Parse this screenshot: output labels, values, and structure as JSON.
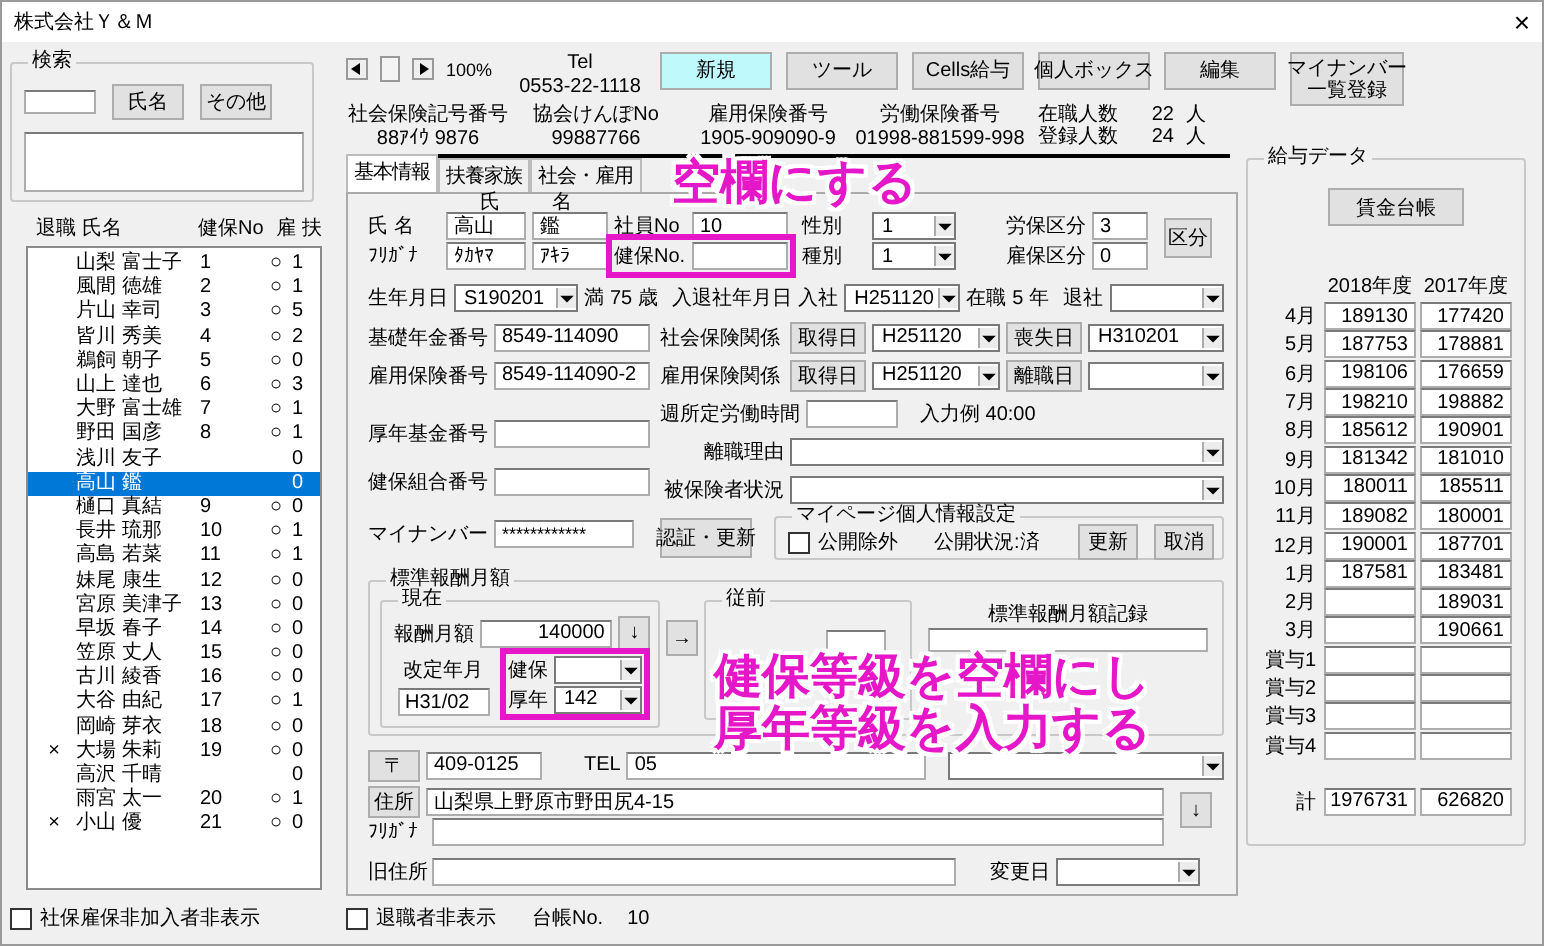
{
  "window": {
    "title": "株式会社Ｙ＆Ｍ",
    "close": "×"
  },
  "search": {
    "label": "検索",
    "buttons": [
      "氏名",
      "その他"
    ]
  },
  "employee_list": {
    "columns": [
      "退職",
      "氏名",
      "健保No",
      "雇",
      "扶"
    ],
    "rows": [
      {
        "name": "山梨 富士子",
        "no": "1",
        "koyo": "○",
        "fu": "1",
        "selected": false
      },
      {
        "name": "風間 徳雄",
        "no": "2",
        "koyo": "○",
        "fu": "1",
        "selected": false
      },
      {
        "name": "片山 幸司",
        "no": "3",
        "koyo": "○",
        "fu": "5",
        "selected": false
      },
      {
        "name": "皆川 秀美",
        "no": "4",
        "koyo": "○",
        "fu": "2",
        "selected": false
      },
      {
        "name": "鵜飼 朝子",
        "no": "5",
        "koyo": "○",
        "fu": "0",
        "selected": false
      },
      {
        "name": "山上 達也",
        "no": "6",
        "koyo": "○",
        "fu": "3",
        "selected": false
      },
      {
        "name": "大野 富士雄",
        "no": "7",
        "koyo": "○",
        "fu": "1",
        "selected": false
      },
      {
        "name": "野田 国彦",
        "no": "8",
        "koyo": "○",
        "fu": "1",
        "selected": false
      },
      {
        "name": "浅川 友子",
        "fu": "0",
        "selected": false
      },
      {
        "name": "高山 鑑",
        "fu": "0",
        "selected": true
      },
      {
        "name": "樋口 真結",
        "no": "9",
        "koyo": "○",
        "fu": "0",
        "selected": false
      },
      {
        "name": "長井 琉那",
        "no": "10",
        "koyo": "○",
        "fu": "1",
        "selected": false
      },
      {
        "name": "高島 若菜",
        "no": "11",
        "koyo": "○",
        "fu": "1",
        "selected": false
      },
      {
        "name": "妹尾 康生",
        "no": "12",
        "koyo": "○",
        "fu": "0",
        "selected": false
      },
      {
        "name": "宮原 美津子",
        "no": "13",
        "koyo": "○",
        "fu": "0",
        "selected": false
      },
      {
        "name": "早坂 春子",
        "no": "14",
        "koyo": "○",
        "fu": "0",
        "selected": false
      },
      {
        "name": "笠原 丈人",
        "no": "15",
        "koyo": "○",
        "fu": "0",
        "selected": false
      },
      {
        "name": "古川 綾香",
        "no": "16",
        "koyo": "○",
        "fu": "0",
        "selected": false
      },
      {
        "name": "大谷 由紀",
        "no": "17",
        "koyo": "○",
        "fu": "1",
        "selected": false
      },
      {
        "name": "岡崎 芽衣",
        "no": "18",
        "koyo": "○",
        "fu": "0",
        "selected": false
      },
      {
        "retired": "×",
        "name": "大場 朱莉",
        "no": "19",
        "koyo": "○",
        "fu": "0",
        "selected": false
      },
      {
        "name": "高沢 千晴",
        "fu": "0",
        "selected": false
      },
      {
        "name": "雨宮 太一",
        "no": "20",
        "koyo": "○",
        "fu": "1",
        "selected": false
      },
      {
        "retired": "×",
        "name": "小山 優",
        "no": "21",
        "koyo": "○",
        "fu": "0",
        "selected": false
      }
    ]
  },
  "hide_uninsured": {
    "label": "社保雇保非加入者非表示",
    "checked": false
  },
  "zoom": "100%",
  "tel": {
    "label": "Tel",
    "value": "0553-22-1118"
  },
  "toolbar": [
    {
      "lines": [
        "新規"
      ],
      "selected": true
    },
    {
      "lines": [
        "ツール"
      ],
      "selected": false
    },
    {
      "lines": [
        "Cells給与"
      ],
      "selected": false
    },
    {
      "lines": [
        "個人ボックス"
      ],
      "selected": false
    },
    {
      "lines": [
        "編集"
      ],
      "selected": false
    },
    {
      "lines": [
        "マイナンバー",
        "一覧登録"
      ],
      "selected": false
    }
  ],
  "insurance_numbers": [
    {
      "label": "社会保険記号番号",
      "value": "88ｱｲｳ 9876"
    },
    {
      "label": "協会けんぽNo",
      "value": "99887766"
    },
    {
      "label": "雇用保険番号",
      "value": "1905-909090-9"
    },
    {
      "label": "労働保険番号",
      "value": "01998-881599-998"
    }
  ],
  "counts": [
    {
      "label": "在職人数",
      "value": "22",
      "unit": "人"
    },
    {
      "label": "登録人数",
      "value": "24",
      "unit": "人"
    }
  ],
  "tabs": [
    {
      "label": "基本情報",
      "selected": true
    },
    {
      "label": "扶養家族",
      "selected": false
    },
    {
      "label": "社会・雇用",
      "selected": false
    }
  ],
  "form": {
    "name_headers": [
      "氏",
      "名"
    ],
    "name": {
      "label": "氏 名",
      "surname": "高山",
      "given": "鑑"
    },
    "furigana": {
      "label": "ﾌﾘｶﾞﾅ",
      "surname": "ﾀｶﾔﾏ",
      "given": "ｱｷﾗ"
    },
    "employee_no": {
      "label": "社員No",
      "value": "10"
    },
    "health_no": {
      "label": "健保No."
    },
    "sex": {
      "label": "性別",
      "value": "1"
    },
    "type": {
      "label": "種別",
      "value": "1"
    },
    "labor_class": {
      "label": "労保区分",
      "value": "3"
    },
    "employment_class": {
      "label": "雇保区分",
      "value": "0"
    },
    "class_button": "区分",
    "birth": {
      "label": "生年月日",
      "value": "S190201",
      "age_prefix": "満",
      "age": "75",
      "age_unit": "歳"
    },
    "join": {
      "label": "入退社年月日",
      "join_label": "入社",
      "join_value": "H251120",
      "tenure_label": "在職",
      "tenure": "5",
      "tenure_unit": "年",
      "leave_label": "退社"
    },
    "pension_no": {
      "label": "基礎年金番号",
      "value": "8549-114090"
    },
    "employment_ins_no": {
      "label": "雇用保険番号",
      "value": "8549-114090-2"
    },
    "pension_fund_no": {
      "label": "厚年基金番号"
    },
    "health_union_no": {
      "label": "健保組合番号"
    },
    "social_ins": {
      "label": "社会保険関係",
      "get_button": "取得日",
      "get_value": "H251120",
      "lose_button": "喪失日",
      "lose_value": "H310201"
    },
    "employment_ins": {
      "label": "雇用保険関係",
      "get_button": "取得日",
      "get_value": "H251120",
      "lose_button": "離職日"
    },
    "weekly_hours": {
      "label": "週所定労働時間",
      "hint": "入力例 40:00"
    },
    "leave_reason": {
      "label": "離職理由"
    },
    "insured_status": {
      "label": "被保険者状況"
    },
    "my_number": {
      "label": "マイナンバー",
      "value": "************",
      "button": "認証・更新"
    },
    "mypage": {
      "title": "マイページ個人情報設定",
      "exclude": {
        "label": "公開除外",
        "checked": false
      },
      "status": "公開状況:済",
      "buttons": [
        "更新",
        "取消"
      ]
    },
    "standard_pay": {
      "title": "標準報酬月額",
      "current": {
        "title": "現在",
        "pay_label": "報酬月額",
        "pay": "140000",
        "down": "↓",
        "revised_label": "改定年月",
        "revised": "H31/02",
        "health_label": "健保",
        "pension_label": "厚年",
        "pension": "142"
      },
      "copy": "→",
      "previous": {
        "title": "従前"
      },
      "history": {
        "title": "標準報酬月額記録"
      }
    },
    "postal": {
      "button": "〒",
      "value": "409-0125",
      "tel_label": "TEL",
      "tel": "05"
    },
    "address": {
      "button": "住所",
      "value": "山梨県上野原市野田尻4-15",
      "down": "↓",
      "furigana_label": "ﾌﾘｶﾞﾅ",
      "old_label": "旧住所",
      "changed_label": "変更日"
    }
  },
  "hide_retired": {
    "label": "退職者非表示",
    "checked": false
  },
  "ledger_no": {
    "label": "台帳No.",
    "value": "10"
  },
  "pay_data": {
    "title": "給与データ",
    "ledger_button": "賃金台帳",
    "years": [
      "2018年度",
      "2017年度"
    ],
    "rows": [
      {
        "month": "4月",
        "y2018": "189130",
        "y2017": "177420"
      },
      {
        "month": "5月",
        "y2018": "187753",
        "y2017": "178881"
      },
      {
        "month": "6月",
        "y2018": "198106",
        "y2017": "176659"
      },
      {
        "month": "7月",
        "y2018": "198210",
        "y2017": "198882"
      },
      {
        "month": "8月",
        "y2018": "185612",
        "y2017": "190901"
      },
      {
        "month": "9月",
        "y2018": "181342",
        "y2017": "181010"
      },
      {
        "month": "10月",
        "y2018": "180011",
        "y2017": "185511"
      },
      {
        "month": "11月",
        "y2018": "189082",
        "y2017": "180001"
      },
      {
        "month": "12月",
        "y2018": "190001",
        "y2017": "187701"
      },
      {
        "month": "1月",
        "y2018": "187581",
        "y2017": "183481"
      },
      {
        "month": "2月",
        "y2017": "189031"
      },
      {
        "month": "3月",
        "y2017": "190661"
      },
      {
        "month": "賞与1"
      },
      {
        "month": "賞与2"
      },
      {
        "month": "賞与3"
      },
      {
        "month": "賞与4"
      }
    ],
    "total": {
      "label": "計",
      "values": [
        "1976731",
        "626820"
      ]
    }
  },
  "annotations": [
    {
      "text": "空欄にする"
    },
    {
      "text": "健保等級を空欄にし"
    },
    {
      "text": "厚年等級を入力する"
    }
  ]
}
